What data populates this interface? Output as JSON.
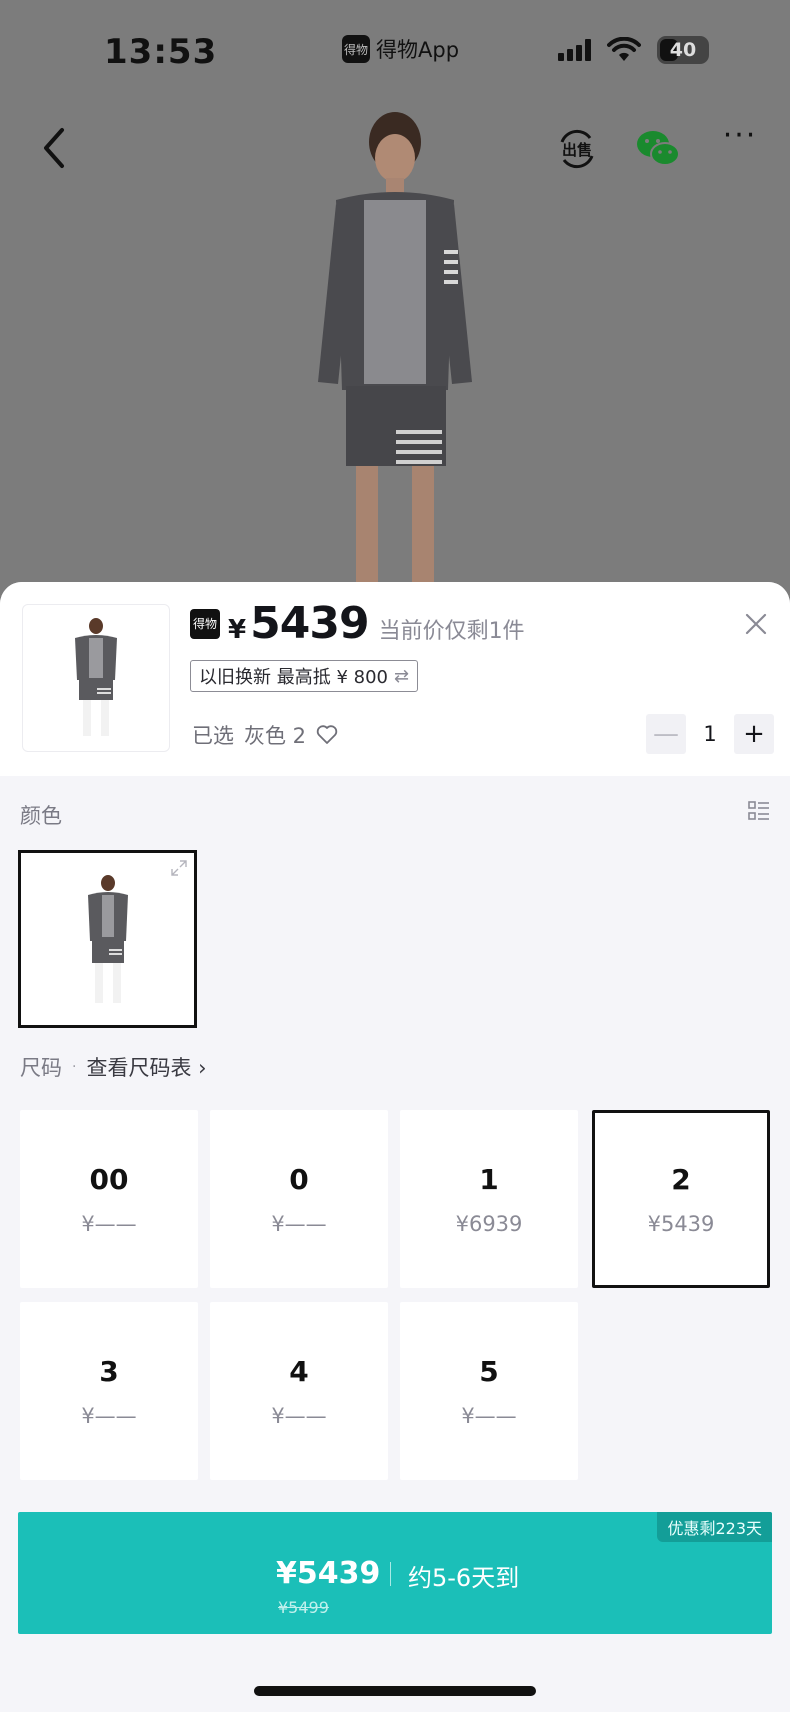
{
  "status_bar": {
    "time": "13:53",
    "app_name": "得物App",
    "app_logo_text": "得物",
    "battery": "40",
    "icons": [
      "signal-icon",
      "wifi-icon",
      "battery-icon"
    ]
  },
  "nav": {
    "icons": [
      "back-icon",
      "sell-icon",
      "wechat-icon",
      "more-icon"
    ],
    "more_label": "···"
  },
  "sheet": {
    "header": {
      "badge_text": "得物",
      "currency": "¥",
      "price": "5439",
      "price_note": "当前价仅剩1件",
      "tradein_label": "以旧换新 最高抵 ¥ 800",
      "tradein_icon": "⇄",
      "selected_label": "已选",
      "selected_value": "灰色 2",
      "quantity": "1",
      "qty_minus": "—",
      "qty_plus": "+"
    },
    "color_section": {
      "label": "颜色",
      "selected_color": "灰色"
    },
    "size_section": {
      "label": "尺码",
      "separator": "·",
      "chart_link": "查看尺码表 ›",
      "sizes": [
        {
          "name": "00",
          "price": "¥——",
          "selected": false
        },
        {
          "name": "0",
          "price": "¥——",
          "selected": false
        },
        {
          "name": "1",
          "price": "¥6939",
          "selected": false
        },
        {
          "name": "2",
          "price": "¥5439",
          "selected": true
        },
        {
          "name": "3",
          "price": "¥——",
          "selected": false
        },
        {
          "name": "4",
          "price": "¥——",
          "selected": false
        },
        {
          "name": "5",
          "price": "¥——",
          "selected": false
        }
      ]
    },
    "buy_button": {
      "tag": "优惠剩223天",
      "price": "¥5439",
      "original_price": "¥5499",
      "eta": "约5-6天到"
    }
  },
  "colors": {
    "accent": "#1bbfb8",
    "accent_dark": "#139e98",
    "sheet_bg": "#f5f5f9",
    "backdrop": "#7c7c7c"
  }
}
